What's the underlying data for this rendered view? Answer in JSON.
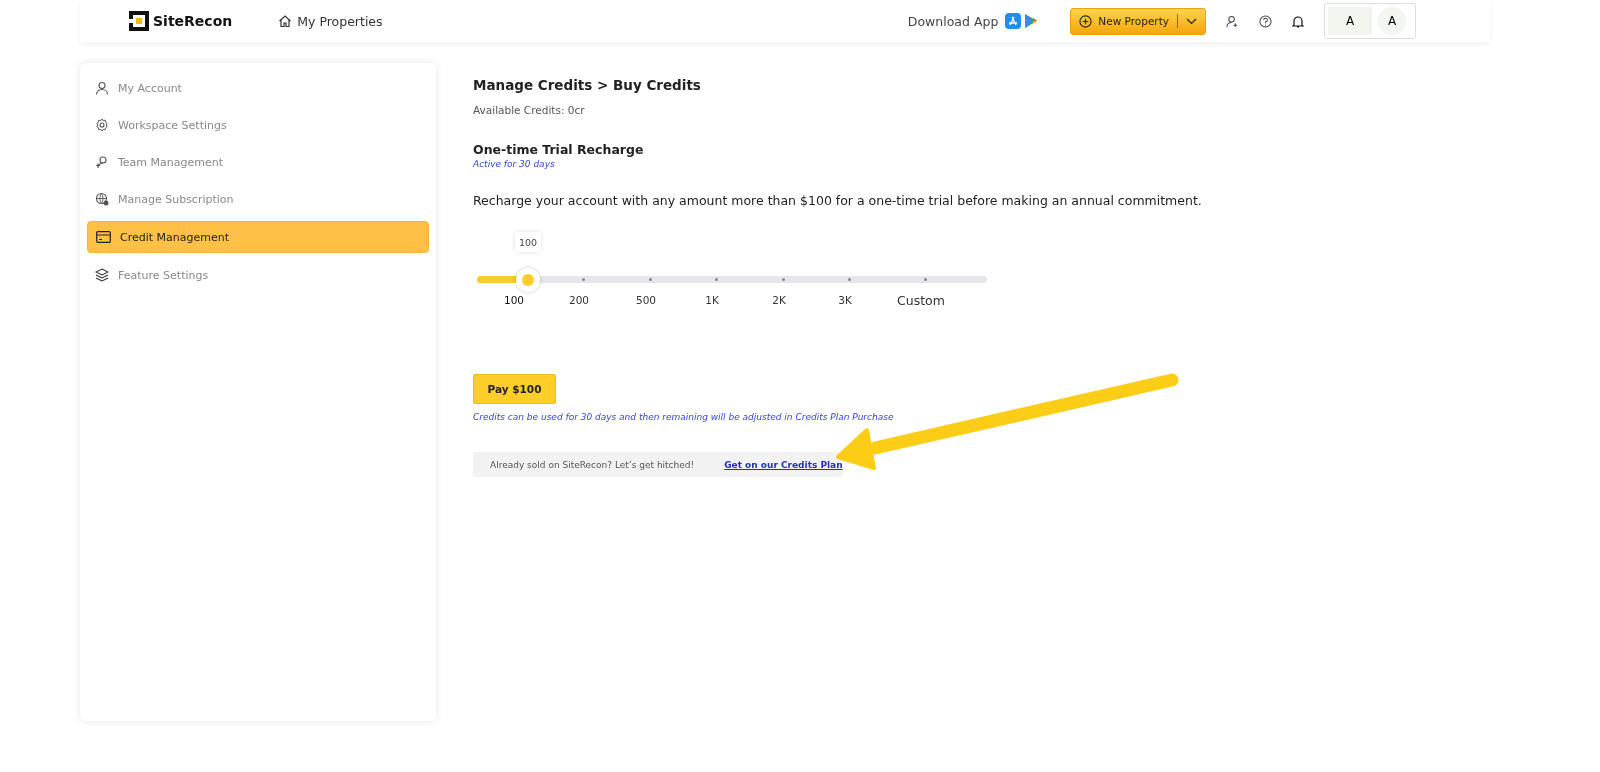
{
  "header": {
    "logo": "SiteRecon",
    "nav": "My Properties",
    "download": "Download App",
    "new_button": "New Property",
    "avatars": [
      "A",
      "A"
    ]
  },
  "sidebar": {
    "items": [
      {
        "label": "My Account",
        "selected": false
      },
      {
        "label": "Workspace Settings",
        "selected": false
      },
      {
        "label": "Team Management",
        "selected": false
      },
      {
        "label": "Manage Subscription",
        "selected": false
      },
      {
        "label": "Credit Management",
        "selected": true
      },
      {
        "label": "Feature Settings",
        "selected": false
      }
    ]
  },
  "main": {
    "breadcrumb": "Manage Credits > Buy Credits",
    "available": "Available Credits: 0cr",
    "section_title": "One-time Trial Recharge",
    "section_note": "Active for 30 days",
    "description": "Recharge your account with any amount more than $100 for a one-time trial before making an annual commitment.",
    "slider": {
      "tooltip": "100",
      "level": 0.1,
      "stops": [
        {
          "label": "100",
          "selected": true
        },
        {
          "label": "200",
          "selected": false
        },
        {
          "label": "500",
          "selected": false
        },
        {
          "label": "1K",
          "selected": false
        },
        {
          "label": "2K",
          "selected": false
        },
        {
          "label": "3K",
          "selected": false
        },
        {
          "label": "Custom",
          "selected": false
        }
      ]
    },
    "pay_button": "Pay $100",
    "note": "Credits can be used for 30 days and then remaining will be adjusted in Credits Plan Purchase",
    "banner": {
      "text": "Already sold on SiteRecon? Let’s get hitched!",
      "link": "Get on our Credits Plan"
    }
  }
}
